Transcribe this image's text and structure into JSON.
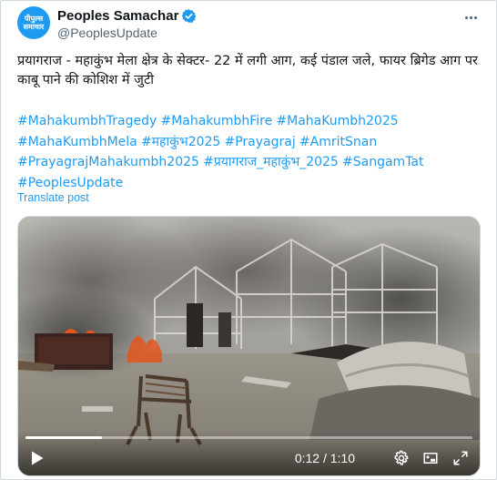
{
  "account": {
    "display_name": "Peoples Samachar",
    "handle": "@PeoplesUpdate",
    "avatar_text_line1": "पीपुल्स",
    "avatar_text_line2": "समाचार"
  },
  "post": {
    "text": "प्रयागराज - महाकुंभ मेला क्षेत्र के सेक्टर- 22 में लगी आग, कई पंडाल जले, फायर ब्रिगेड आग पर काबू पाने की कोशिश में जुटी",
    "hashtags": [
      "#MahakumbhTragedy",
      "#MahakumbhFire",
      "#MahaKumbh2025",
      "#MahaKumbhMela",
      "#महाकुंभ2025",
      "#Prayagraj",
      "#AmritSnan",
      "#PrayagrajMahakumbh2025",
      "#प्रयागराज_महाकुंभ_2025",
      "#SangamTat",
      "#PeoplesUpdate"
    ],
    "translate_label": "Translate post"
  },
  "video": {
    "time_display": "0:12 / 1:10",
    "progress_fraction": 0.171
  },
  "colors": {
    "link": "#1d9bf0",
    "verified": "#1d9bf0",
    "text": "#0f1419",
    "secondary": "#536471"
  },
  "icons": {
    "verified": "verified-badge-icon",
    "more": "more-icon",
    "play": "play-icon",
    "settings": "settings-gear-icon",
    "dock": "dock-icon",
    "fullscreen": "fullscreen-icon"
  }
}
